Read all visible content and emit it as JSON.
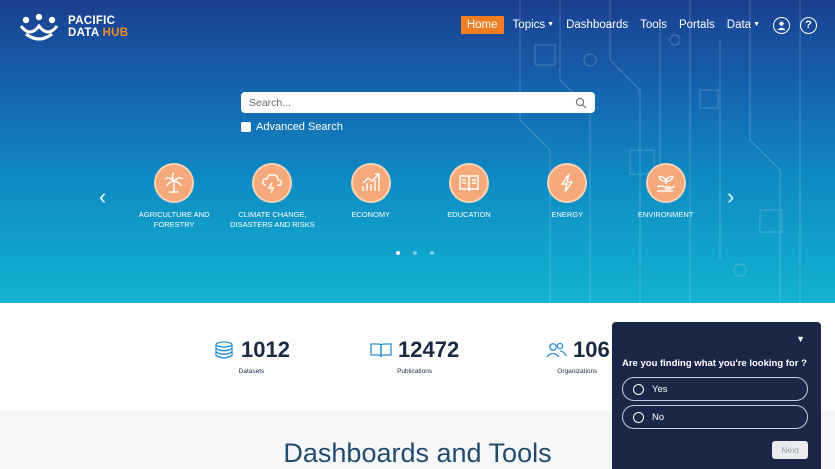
{
  "brand": {
    "line1": "PACIFIC",
    "line2a": "DATA",
    "line2b": "HUB"
  },
  "nav": {
    "home": "Home",
    "topics": "Topics",
    "dashboards": "Dashboards",
    "tools": "Tools",
    "portals": "Portals",
    "data": "Data",
    "account_icon": "user-circle-icon",
    "help_icon": "question-circle-icon",
    "help_glyph": "?"
  },
  "search": {
    "placeholder": "Search...",
    "advanced_label": "Advanced Search"
  },
  "carousel": {
    "prev": "‹",
    "next": "›",
    "topics": [
      {
        "label": "AGRICULTURE AND\nFORESTRY",
        "icon": "palm-tree-icon"
      },
      {
        "label": "CLIMATE CHANGE,\nDISASTERS AND RISKS",
        "icon": "storm-cloud-icon"
      },
      {
        "label": "ECONOMY",
        "icon": "growth-chart-icon"
      },
      {
        "label": "EDUCATION",
        "icon": "book-icon"
      },
      {
        "label": "ENERGY",
        "icon": "lightning-icon"
      },
      {
        "label": "ENVIRONMENT",
        "icon": "plant-hand-icon"
      }
    ],
    "active_page": 1,
    "page_count": 3
  },
  "stats": [
    {
      "value": "1012",
      "label": "Datasets",
      "icon": "database-icon"
    },
    {
      "value": "12472",
      "label": "Publications",
      "icon": "open-book-icon"
    },
    {
      "value": "106",
      "label": "Organizations",
      "icon": "people-icon"
    }
  ],
  "section_title": "Dashboards and Tools",
  "survey": {
    "question": "Are you finding what you're looking for ?",
    "options": [
      "Yes",
      "No"
    ],
    "next_label": "Next"
  },
  "colors": {
    "accent": "#ef7d22",
    "hero_top": "#1a3f8f",
    "hero_bottom": "#12b3d0",
    "topic_circle": "#f5a87a",
    "survey_bg": "#1b2748"
  }
}
